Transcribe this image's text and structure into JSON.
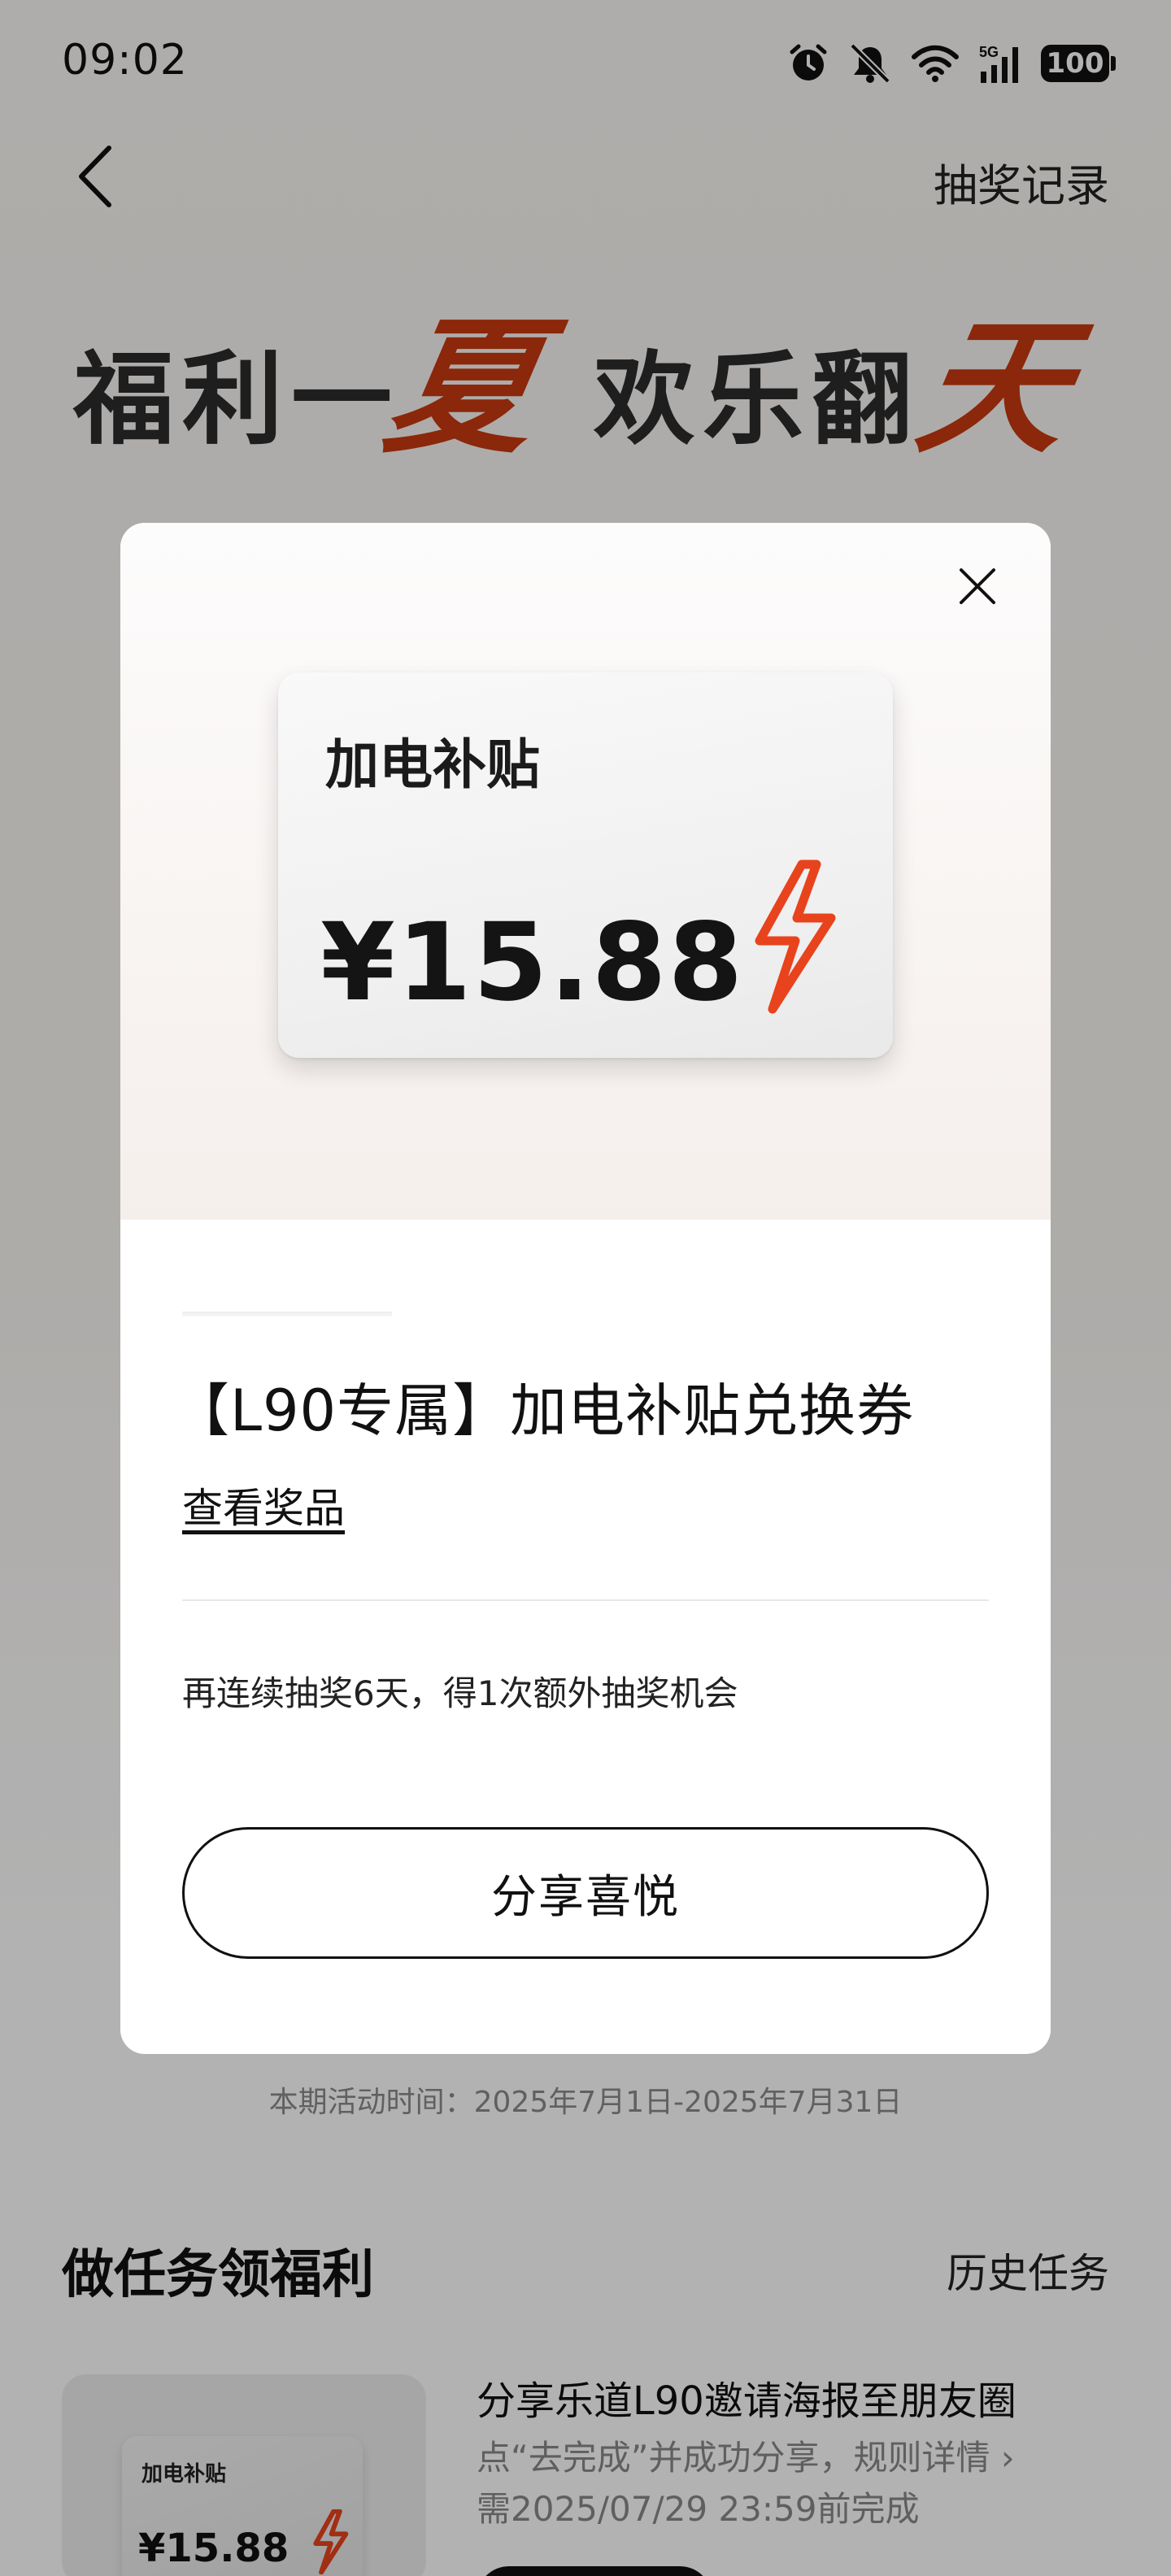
{
  "status_bar": {
    "time": "09:02",
    "network": "5G",
    "battery": "100",
    "icons": [
      "alarm-icon",
      "bell-muted-icon",
      "wifi-icon",
      "signal-icon",
      "battery-icon"
    ]
  },
  "nav": {
    "back_icon": "chevron-left-icon",
    "history_link": "抽奖记录"
  },
  "hero": {
    "part1": "福利一",
    "accent1": "夏",
    "part2": "欢乐翻",
    "accent2": "天"
  },
  "modal": {
    "close_icon": "close-icon",
    "coupon": {
      "title": "加电补贴",
      "amount": "¥15.88",
      "icon": "lightning-icon"
    },
    "prize_title": "【L90专属】加电补贴兑换券",
    "view_prize": "查看奖品",
    "streak_text": "再连续抽奖6天，得1次额外抽奖机会",
    "share_button": "分享喜悦"
  },
  "activity": {
    "period": "本期活动时间：2025年7月1日-2025年7月31日"
  },
  "tasks": {
    "title": "做任务领福利",
    "history": "历史任务",
    "items": [
      {
        "thumb_title": "加电补贴",
        "thumb_amount": "¥15.88",
        "title": "分享乐道L90邀请海报至朋友圈",
        "desc": "点“去完成”并成功分享，规则详情 ›",
        "deadline": "需2025/07/29 23:59前完成"
      }
    ]
  },
  "colors": {
    "accent": "#c8380f",
    "bolt": "#e8431c",
    "text": "#111111",
    "muted": "#888888"
  }
}
